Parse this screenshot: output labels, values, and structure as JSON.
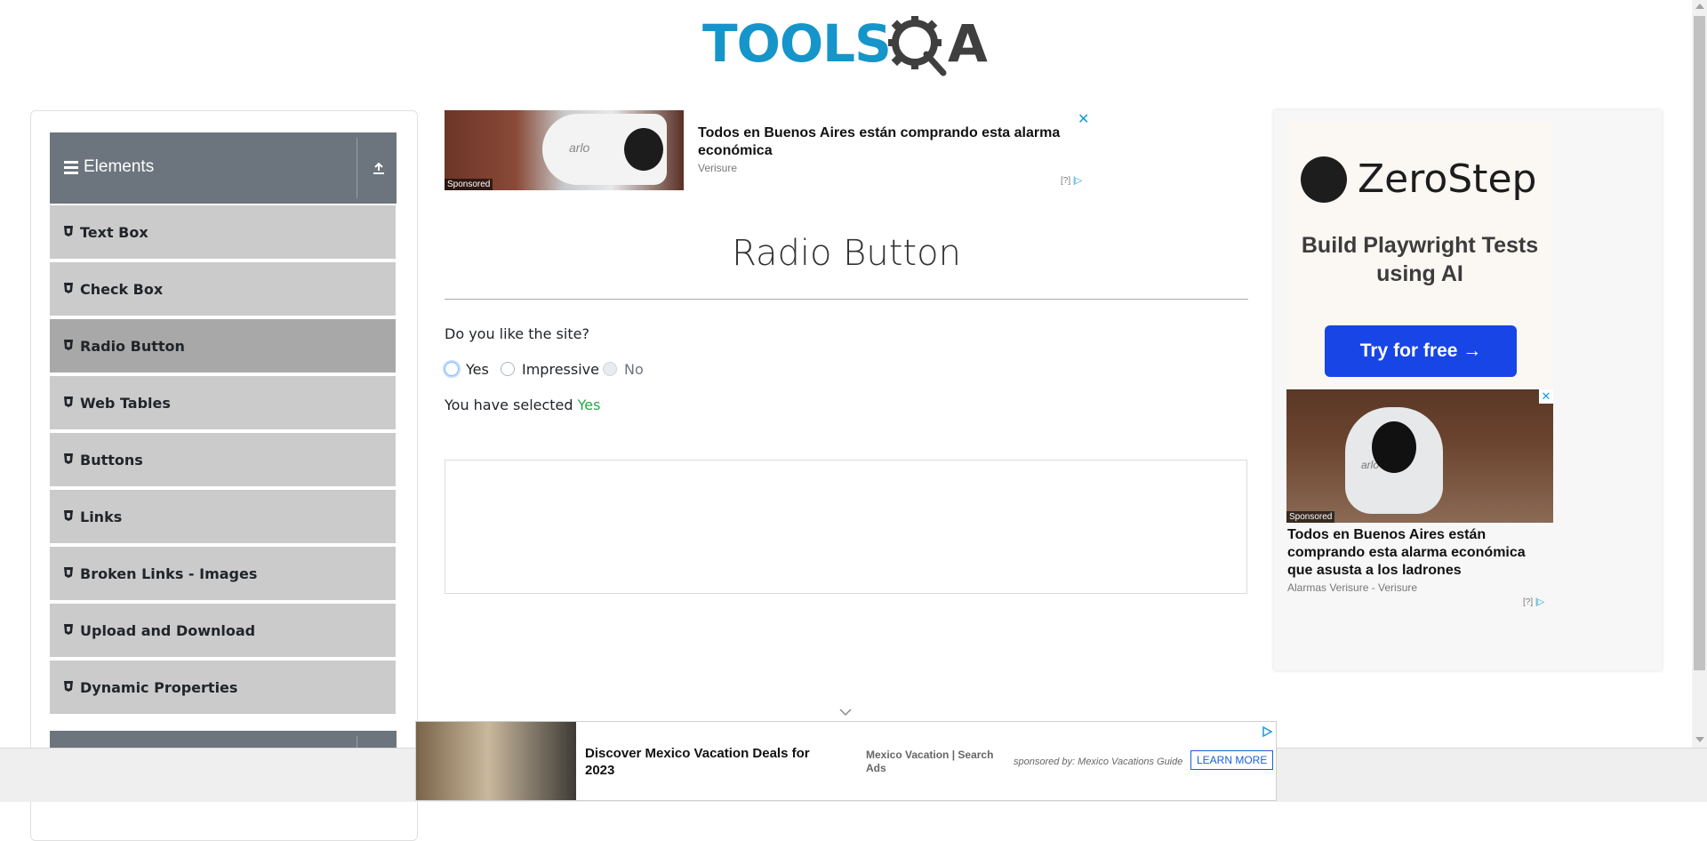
{
  "header": {
    "logo_text_left": "TOOLS",
    "logo_text_right": "A",
    "logo_gear_letter": "Q"
  },
  "sidebar": {
    "group_title": "Elements",
    "items": [
      {
        "label": "Text Box",
        "active": false
      },
      {
        "label": "Check Box",
        "active": false
      },
      {
        "label": "Radio Button",
        "active": true
      },
      {
        "label": "Web Tables",
        "active": false
      },
      {
        "label": "Buttons",
        "active": false
      },
      {
        "label": "Links",
        "active": false
      },
      {
        "label": "Broken Links - Images",
        "active": false
      },
      {
        "label": "Upload and Download",
        "active": false
      },
      {
        "label": "Dynamic Properties",
        "active": false
      }
    ]
  },
  "top_ad": {
    "title": "Todos en Buenos Aires están comprando esta alarma económica",
    "source": "Verisure",
    "brand": "arlo",
    "sponsored": "Sponsored",
    "close": "✕",
    "info": "[?]"
  },
  "main": {
    "title": "Radio Button",
    "question": "Do you like the site?",
    "options": [
      {
        "label": "Yes",
        "checked": true,
        "disabled": false
      },
      {
        "label": "Impressive",
        "checked": false,
        "disabled": false
      },
      {
        "label": "No",
        "checked": false,
        "disabled": true
      }
    ],
    "result_prefix": "You have selected ",
    "result_value": "Yes"
  },
  "right_ad": {
    "brand": "ZeroStep",
    "tagline": "Build Playwright Tests using AI",
    "cta": "Try for free →",
    "ad2_title": "Todos en Buenos Aires están comprando esta alarma económica que asusta a los ladrones",
    "ad2_source": "Alarmas Verisure - Verisure",
    "ad2_brand": "arlo",
    "sponsored": "Sponsored",
    "close": "✕",
    "info": "[?]"
  },
  "bottom_ad": {
    "title": "Discover Mexico Vacation Deals for 2023",
    "source": "Mexico Vacation | Search Ads",
    "sponsor": "sponsored by: Mexico Vacations Guide",
    "button": "LEARN MORE"
  },
  "colors": {
    "accent_blue": "#1595c9",
    "sidebar_header": "#6c757d",
    "menu_item": "#cbcbcb",
    "menu_item_active": "#a8a8a8",
    "success": "#28a745",
    "cta_blue": "#1845e6"
  }
}
